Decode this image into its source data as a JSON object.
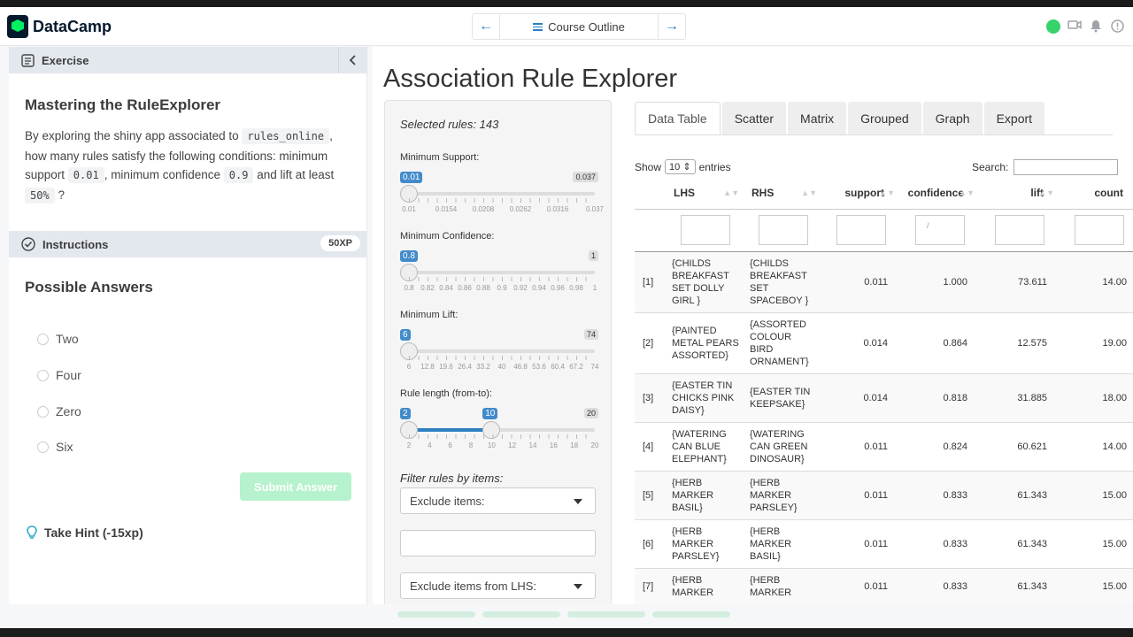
{
  "topbar": {
    "app_name": "DataCamp",
    "nav_prev": "←",
    "nav_title": "Course Outline",
    "nav_next": "→",
    "icons": [
      "status-online",
      "video-icon",
      "bell-icon",
      "info-icon"
    ]
  },
  "exercise": {
    "header": "Exercise",
    "title": "Mastering the RuleExplorer",
    "q_part1": "By exploring the shiny app associated to ",
    "q_code1": "rules_online",
    "q_part2": ", how many rules satisfy the following conditions: minimum support ",
    "q_code2": "0.01",
    "q_part3": ", minimum confidence ",
    "q_code3": "0.9",
    "q_part4": " and lift at least ",
    "q_code4": "50%",
    "q_part5": " ?"
  },
  "instructions": {
    "header": "Instructions",
    "xp": "50XP",
    "answers_title": "Possible Answers",
    "answers": [
      "Two",
      "Four",
      "Zero",
      "Six"
    ],
    "submit_label": "Submit Answer",
    "hint_label": "Take Hint (-15xp)"
  },
  "app": {
    "title": "Association Rule Explorer",
    "selected_rules": "Selected rules: 143",
    "sliders": [
      {
        "label": "Minimum Support:",
        "min_label": "0.01",
        "max_label": "0.037",
        "value_label": "0.01",
        "ticks": [
          "0.01",
          "0.0154",
          "0.0208",
          "0.0262",
          "0.0316",
          "0.037"
        ],
        "position": 0
      },
      {
        "label": "Minimum Confidence:",
        "min_label": "0.8",
        "max_label": "1",
        "value_label": "0.8",
        "ticks": [
          "0.8",
          "0.82",
          "0.84",
          "0.86",
          "0.88",
          "0.9",
          "0.92",
          "0.94",
          "0.96",
          "0.98",
          "1"
        ],
        "position": 0
      },
      {
        "label": "Minimum Lift:",
        "min_label": "6",
        "max_label": "74",
        "value_label": "6",
        "ticks": [
          "6",
          "12.8",
          "19.6",
          "26.4",
          "33.2",
          "40",
          "46.8",
          "53.6",
          "60.4",
          "67.2",
          "74"
        ],
        "position": 0
      },
      {
        "label": "Rule length (from-to):",
        "min_label": "2",
        "max_label": "20",
        "value_label": "2",
        "value_label2": "10",
        "ticks": [
          "2",
          "4",
          "6",
          "8",
          "10",
          "12",
          "14",
          "16",
          "18",
          "20"
        ],
        "position": 0,
        "position2": 0.444
      }
    ],
    "filter_label": "Filter rules by items:",
    "exclude_items": "Exclude items:",
    "exclude_lhs": "Exclude items from LHS:",
    "tabs": [
      "Data Table",
      "Scatter",
      "Matrix",
      "Grouped",
      "Graph",
      "Export"
    ],
    "active_tab": "Data Table",
    "show_label": "Show",
    "show_value": "10",
    "entries_label": "entries",
    "search_label": "Search:",
    "table": {
      "headers": [
        "",
        "LHS",
        "RHS",
        "support",
        "confidence",
        "lift",
        "count"
      ],
      "confidence_filter": "/",
      "rows": [
        {
          "idx": "[1]",
          "lhs": "{CHILDS BREAKFAST SET DOLLY GIRL }",
          "rhs": "{CHILDS BREAKFAST SET SPACEBOY }",
          "support": "0.011",
          "confidence": "1.000",
          "lift": "73.611",
          "count": "14.00"
        },
        {
          "idx": "[2]",
          "lhs": "{PAINTED METAL PEARS ASSORTED}",
          "rhs": "{ASSORTED COLOUR BIRD ORNAMENT}",
          "support": "0.014",
          "confidence": "0.864",
          "lift": "12.575",
          "count": "19.00"
        },
        {
          "idx": "[3]",
          "lhs": "{EASTER TIN CHICKS PINK DAISY}",
          "rhs": "{EASTER TIN KEEPSAKE}",
          "support": "0.014",
          "confidence": "0.818",
          "lift": "31.885",
          "count": "18.00"
        },
        {
          "idx": "[4]",
          "lhs": "{WATERING CAN BLUE ELEPHANT}",
          "rhs": "{WATERING CAN GREEN DINOSAUR}",
          "support": "0.011",
          "confidence": "0.824",
          "lift": "60.621",
          "count": "14.00"
        },
        {
          "idx": "[5]",
          "lhs": "{HERB MARKER BASIL}",
          "rhs": "{HERB MARKER PARSLEY}",
          "support": "0.011",
          "confidence": "0.833",
          "lift": "61.343",
          "count": "15.00"
        },
        {
          "idx": "[6]",
          "lhs": "{HERB MARKER PARSLEY}",
          "rhs": "{HERB MARKER BASIL}",
          "support": "0.011",
          "confidence": "0.833",
          "lift": "61.343",
          "count": "15.00"
        },
        {
          "idx": "[7]",
          "lhs": "{HERB MARKER",
          "rhs": "{HERB MARKER",
          "support": "0.011",
          "confidence": "0.833",
          "lift": "61.343",
          "count": "15.00"
        }
      ]
    }
  }
}
